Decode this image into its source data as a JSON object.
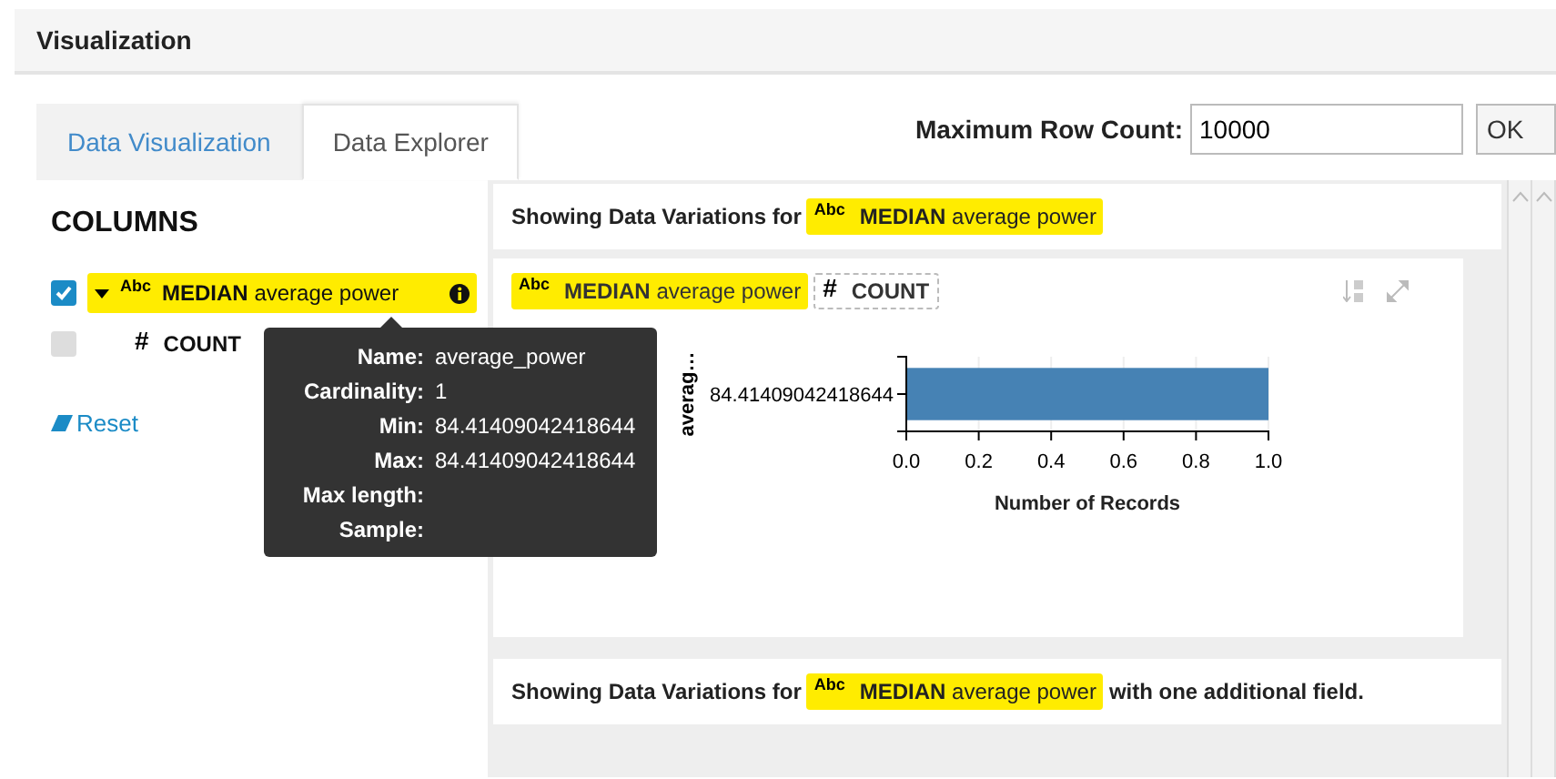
{
  "panel": {
    "title": "Visualization"
  },
  "tabs": [
    {
      "label": "Data Visualization",
      "selected": false
    },
    {
      "label": "Data Explorer",
      "selected": true
    }
  ],
  "row_count": {
    "label": "Maximum Row Count:",
    "value": "10000",
    "button": "OK"
  },
  "columns_panel": {
    "title": "COLUMNS",
    "reset": "Reset",
    "items": [
      {
        "kind": "dimension",
        "type": "Abc",
        "label": "**MEDIAN** average power",
        "checked": true,
        "expanded": true
      },
      {
        "kind": "measure",
        "type": "#",
        "label": "COUNT",
        "checked": false,
        "expanded": false
      }
    ]
  },
  "tooltip": {
    "rows": [
      {
        "label": "Name:",
        "value": "average_power"
      },
      {
        "label": "Cardinality:",
        "value": "1"
      },
      {
        "label": "Min:",
        "value": "84.41409042418644"
      },
      {
        "label": "Max:",
        "value": "84.41409042418644"
      },
      {
        "label": "Max length:"
      },
      {
        "label": "Sample:"
      }
    ]
  },
  "header": {
    "text": "Showing Data Variations for",
    "field": {
      "kind": "dimension",
      "type": "Abc",
      "label": "**MEDIAN** average power"
    }
  },
  "chart_card": {
    "fields": [
      {
        "kind": "dimension",
        "type": "Abc",
        "label": "**MEDIAN** average power"
      },
      {
        "kind": "measure",
        "type": "#",
        "label": "COUNT"
      }
    ],
    "chart_data": {
      "type": "bar",
      "orientation": "horizontal",
      "xlabel": "Number of Records",
      "ylabel": "averag…",
      "categories": [
        "84.41409042418644"
      ],
      "series": [
        {
          "color": "#4682b4",
          "values": [
            1
          ]
        }
      ],
      "grid": true,
      "xlim": [
        0,
        1
      ],
      "xticks": [
        {
          "value": 0,
          "label": "0.0"
        },
        {
          "value": 0.2,
          "label": "0.2"
        },
        {
          "value": 0.4,
          "label": "0.4"
        },
        {
          "value": 0.6,
          "label": "0.6"
        },
        {
          "value": 0.8,
          "label": "0.8"
        },
        {
          "value": 1,
          "label": "1.0"
        }
      ]
    }
  },
  "footer": {
    "text": "Showing Data Variations for",
    "field": {
      "kind": "dimension",
      "type": "Abc",
      "label": "**MEDIAN** average power"
    },
    "suffix": "with one additional field."
  }
}
